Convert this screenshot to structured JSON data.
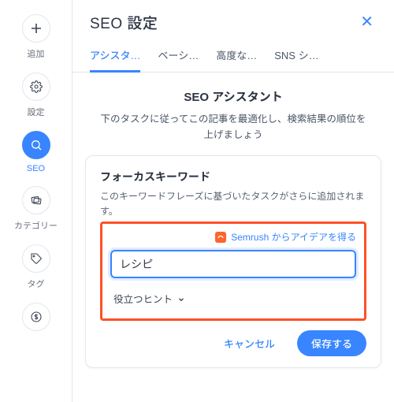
{
  "rail": {
    "items": [
      {
        "name": "add",
        "label": "追加",
        "icon": "plus-icon"
      },
      {
        "name": "settings",
        "label": "設定",
        "icon": "gear-icon"
      },
      {
        "name": "seo",
        "label": "SEO",
        "icon": "search-icon",
        "active": true
      },
      {
        "name": "category",
        "label": "カテゴリー",
        "icon": "cards-icon"
      },
      {
        "name": "tag",
        "label": "タグ",
        "icon": "tag-icon"
      },
      {
        "name": "monetize",
        "label": "",
        "icon": "dollar-icon"
      }
    ]
  },
  "header": {
    "title": "SEO 設定",
    "close_label": "✕"
  },
  "tabs": [
    {
      "label": "アシスタ…",
      "active": true
    },
    {
      "label": "ベーシ…"
    },
    {
      "label": "高度な…"
    },
    {
      "label": "SNS シ…"
    }
  ],
  "assistant": {
    "hero_title": "SEO アシスタント",
    "hero_sub": "下のタスクに従ってこの記事を最適化し、検索結果の順位を上げましょう",
    "card_title": "フォーカスキーワード",
    "card_desc": "このキーワードフレーズに基づいたタスクがさらに追加されます。",
    "semrush_link": "Semrush からアイデアを得る",
    "keyword_value": "レシピ",
    "keyword_placeholder": "",
    "hint_label": "役立つヒント",
    "cancel_label": "キャンセル",
    "save_label": "保存する"
  }
}
